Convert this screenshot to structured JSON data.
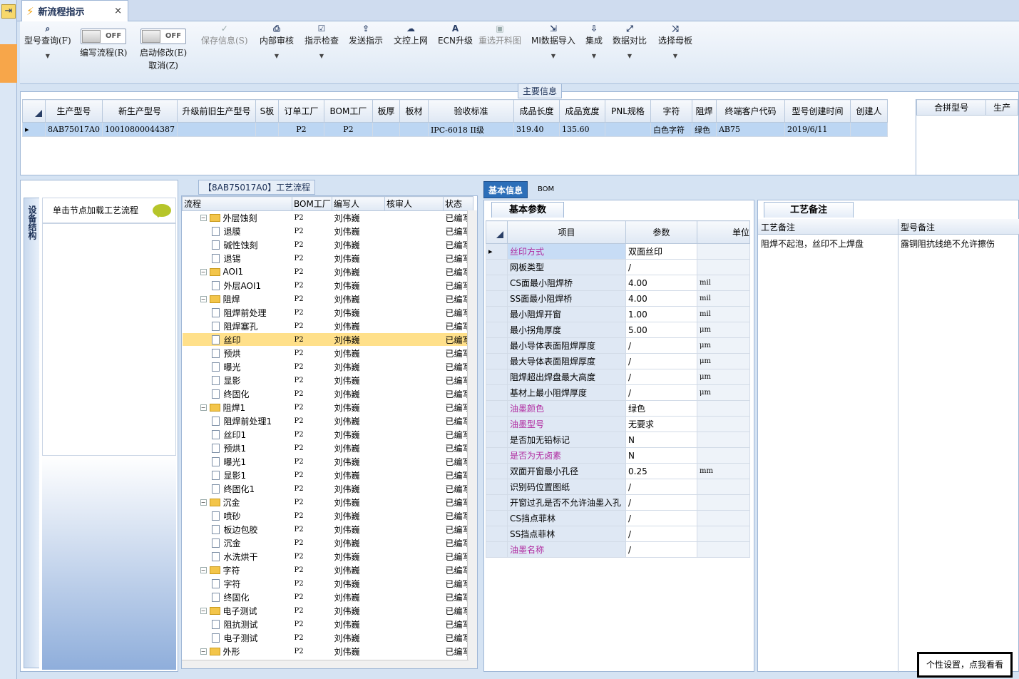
{
  "window": {
    "tab_title": "新流程指示",
    "tab_close": "×"
  },
  "toolbar": {
    "model_query": "型号查询(F)",
    "write_flow": "编写流程(R)",
    "toggle_off": "OFF",
    "enable_modify": "启动修改(E)",
    "cancel": "取消(Z)",
    "save_info": "保存信息(S)",
    "internal_review": "内部审核",
    "instruction_check": "指示检查",
    "send_instruction": "发送指示",
    "file_upload": "文控上网",
    "ecn_upgrade": "ECN升级",
    "reselect_chart": "重选开料图",
    "mi_import": "MI数据导入",
    "integrate": "集成",
    "data_compare": "数据对比",
    "select_master": "选择母板"
  },
  "main_info": {
    "label": "主要信息",
    "columns": [
      "生产型号",
      "新生产型号",
      "升级前旧生产型号",
      "S板",
      "订单工厂",
      "BOM工厂",
      "板厚",
      "板材",
      "验收标准",
      "成品长度",
      "成品宽度",
      "PNL规格",
      "字符",
      "阻焊",
      "终端客户代码",
      "型号创建时间",
      "创建人"
    ],
    "row": [
      "8AB75017A0",
      "10010800044387",
      "",
      "",
      "P2",
      "P2",
      "",
      "",
      "IPC-6018 II级",
      "319.40",
      "135.60",
      "",
      "白色字符",
      "绿色",
      "AB75",
      "2019/6/11",
      ""
    ],
    "merge_columns": [
      "合拼型号",
      "生产"
    ]
  },
  "left": {
    "vertical_tab": "设备结构",
    "hint": "单击节点加载工艺流程"
  },
  "process": {
    "title": "【8AB75017A0】工艺流程",
    "columns": [
      "流程",
      "BOM工厂",
      "编写人",
      "核审人",
      "状态"
    ],
    "rows": [
      {
        "name": "外层蚀刻",
        "lvl": 0
      },
      {
        "name": "退膜",
        "lvl": 1
      },
      {
        "name": "碱性蚀刻",
        "lvl": 1
      },
      {
        "name": "退锡",
        "lvl": 1
      },
      {
        "name": "AOI1",
        "lvl": 0
      },
      {
        "name": "外层AOI1",
        "lvl": 1
      },
      {
        "name": "阻焊",
        "lvl": 0
      },
      {
        "name": "阻焊前处理",
        "lvl": 1
      },
      {
        "name": "阻焊塞孔",
        "lvl": 1
      },
      {
        "name": "丝印",
        "lvl": 1,
        "hl": true
      },
      {
        "name": "预烘",
        "lvl": 1
      },
      {
        "name": "曝光",
        "lvl": 1
      },
      {
        "name": "显影",
        "lvl": 1
      },
      {
        "name": "终固化",
        "lvl": 1
      },
      {
        "name": "阻焊1",
        "lvl": 0
      },
      {
        "name": "阻焊前处理1",
        "lvl": 1
      },
      {
        "name": "丝印1",
        "lvl": 1
      },
      {
        "name": "预烘1",
        "lvl": 1
      },
      {
        "name": "曝光1",
        "lvl": 1
      },
      {
        "name": "显影1",
        "lvl": 1
      },
      {
        "name": "终固化1",
        "lvl": 1
      },
      {
        "name": "沉金",
        "lvl": 0
      },
      {
        "name": "喷砂",
        "lvl": 1
      },
      {
        "name": "板边包胶",
        "lvl": 1
      },
      {
        "name": "沉金",
        "lvl": 1
      },
      {
        "name": "水洗烘干",
        "lvl": 1
      },
      {
        "name": "字符",
        "lvl": 0
      },
      {
        "name": "字符",
        "lvl": 1
      },
      {
        "name": "终固化",
        "lvl": 1
      },
      {
        "name": "电子测试",
        "lvl": 0
      },
      {
        "name": "阻抗测试",
        "lvl": 1
      },
      {
        "name": "电子测试",
        "lvl": 1
      },
      {
        "name": "外形",
        "lvl": 0
      }
    ],
    "factory": "P2",
    "writer": "刘伟巍",
    "status": "已编写"
  },
  "tabs": {
    "basic": "基本信息",
    "bom": "BOM",
    "basic_params": "基本参数",
    "process_notes": "工艺备注"
  },
  "params": {
    "columns": [
      "项目",
      "参数",
      "单位"
    ],
    "rows": [
      {
        "item": "丝印方式",
        "val": "双面丝印",
        "unit": "",
        "pink": true
      },
      {
        "item": "网板类型",
        "val": "/",
        "unit": ""
      },
      {
        "item": "CS面最小阻焊桥",
        "val": "4.00",
        "unit": "mil"
      },
      {
        "item": "SS面最小阻焊桥",
        "val": "4.00",
        "unit": "mil"
      },
      {
        "item": "最小阻焊开窗",
        "val": "1.00",
        "unit": "mil"
      },
      {
        "item": "最小拐角厚度",
        "val": "5.00",
        "unit": "μm"
      },
      {
        "item": "最小导体表面阻焊厚度",
        "val": "/",
        "unit": "μm"
      },
      {
        "item": "最大导体表面阻焊厚度",
        "val": "/",
        "unit": "μm"
      },
      {
        "item": "阻焊超出焊盘最大高度",
        "val": "/",
        "unit": "μm"
      },
      {
        "item": "基材上最小阻焊厚度",
        "val": "/",
        "unit": "μm"
      },
      {
        "item": "油墨颜色",
        "val": "绿色",
        "unit": "",
        "pink": true
      },
      {
        "item": "油墨型号",
        "val": "无要求",
        "unit": "",
        "pink": true
      },
      {
        "item": "是否加无铅标记",
        "val": "N",
        "unit": ""
      },
      {
        "item": "是否为无卤素",
        "val": "N",
        "unit": "",
        "pink": true
      },
      {
        "item": "双面开窗最小孔径",
        "val": "0.25",
        "unit": "mm"
      },
      {
        "item": "识别码位置图纸",
        "val": "/",
        "unit": ""
      },
      {
        "item": "开窗过孔是否不允许油墨入孔",
        "val": "/",
        "unit": ""
      },
      {
        "item": "CS挡点菲林",
        "val": "/",
        "unit": ""
      },
      {
        "item": "SS挡点菲林",
        "val": "/",
        "unit": ""
      },
      {
        "item": "油墨名称",
        "val": "/",
        "unit": "",
        "pink": true
      }
    ]
  },
  "notes": {
    "col1": "工艺备注",
    "col2": "型号备注",
    "val1": "阻焊不起泡，丝印不上焊盘",
    "val2": "露铜阻抗线绝不允许擦伤"
  },
  "footer": {
    "personal": "个性设置，点我看看"
  }
}
